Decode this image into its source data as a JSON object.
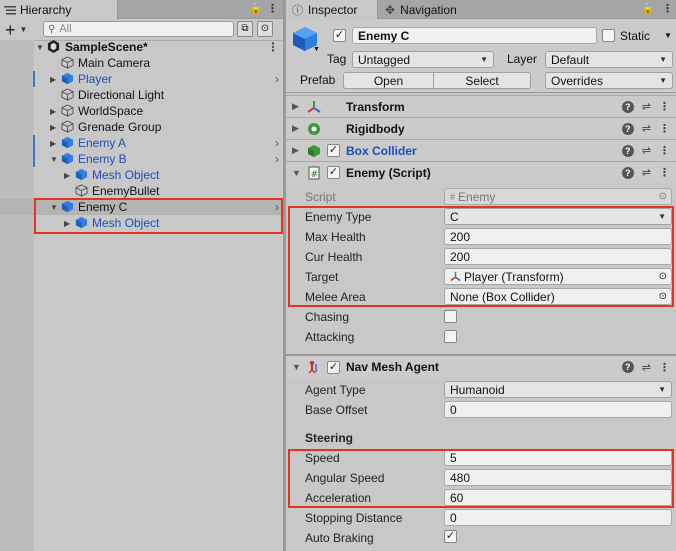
{
  "hierarchy": {
    "tab_label": "Hierarchy",
    "search_placeholder": "All",
    "tree": [
      {
        "label": "SampleScene*",
        "depth": 0,
        "expanded": true,
        "kind": "scene",
        "bold": true
      },
      {
        "label": "Main Camera",
        "depth": 1,
        "kind": "gameobject"
      },
      {
        "label": "Player",
        "depth": 1,
        "kind": "prefab",
        "collapsed": true,
        "has_children_chevron": true
      },
      {
        "label": "Directional Light",
        "depth": 1,
        "kind": "gameobject"
      },
      {
        "label": "WorldSpace",
        "depth": 1,
        "kind": "gameobject",
        "collapsed": true
      },
      {
        "label": "Grenade Group",
        "depth": 1,
        "kind": "gameobject",
        "collapsed": true
      },
      {
        "label": "Enemy A",
        "depth": 1,
        "kind": "prefab",
        "collapsed": true,
        "has_children_chevron": true
      },
      {
        "label": "Enemy B",
        "depth": 1,
        "kind": "prefab",
        "expanded": true,
        "has_children_chevron": true
      },
      {
        "label": "Mesh Object",
        "depth": 2,
        "kind": "prefab",
        "collapsed": true
      },
      {
        "label": "EnemyBullet",
        "depth": 2,
        "kind": "prefab-missing"
      },
      {
        "label": "Enemy C",
        "depth": 1,
        "kind": "prefab",
        "expanded": true,
        "selected": true,
        "has_children_chevron": true
      },
      {
        "label": "Mesh Object",
        "depth": 2,
        "kind": "prefab",
        "collapsed": true
      }
    ]
  },
  "inspector": {
    "tab_inspector": "Inspector",
    "tab_navigation": "Navigation",
    "object": {
      "name": "Enemy C",
      "static_label": "Static",
      "tag_label": "Tag",
      "tag_value": "Untagged",
      "layer_label": "Layer",
      "layer_value": "Default",
      "prefab_label": "Prefab",
      "open_label": "Open",
      "select_label": "Select",
      "overrides_label": "Overrides"
    },
    "components": {
      "transform": "Transform",
      "rigidbody": "Rigidbody",
      "box_collider": "Box Collider",
      "enemy_script": "Enemy (Script)",
      "nav_mesh_agent": "Nav Mesh Agent"
    },
    "enemy_script": {
      "script_label": "Script",
      "script_value": "Enemy",
      "enemy_type_label": "Enemy Type",
      "enemy_type_value": "C",
      "max_health_label": "Max Health",
      "max_health_value": "200",
      "cur_health_label": "Cur Health",
      "cur_health_value": "200",
      "target_label": "Target",
      "target_value": "Player (Transform)",
      "melee_area_label": "Melee Area",
      "melee_area_value": "None (Box Collider)",
      "chasing_label": "Chasing",
      "attacking_label": "Attacking"
    },
    "nav_mesh_agent": {
      "agent_type_label": "Agent Type",
      "agent_type_value": "Humanoid",
      "base_offset_label": "Base Offset",
      "base_offset_value": "0",
      "steering_header": "Steering",
      "speed_label": "Speed",
      "speed_value": "5",
      "angular_speed_label": "Angular Speed",
      "angular_speed_value": "480",
      "acceleration_label": "Acceleration",
      "acceleration_value": "60",
      "stopping_distance_label": "Stopping Distance",
      "stopping_distance_value": "0",
      "auto_braking_label": "Auto Braking"
    }
  },
  "colors": {
    "highlight_box": "#e5341d",
    "prefab_blue": "#1a4fb5",
    "panel_bg": "#c8c8c8"
  }
}
